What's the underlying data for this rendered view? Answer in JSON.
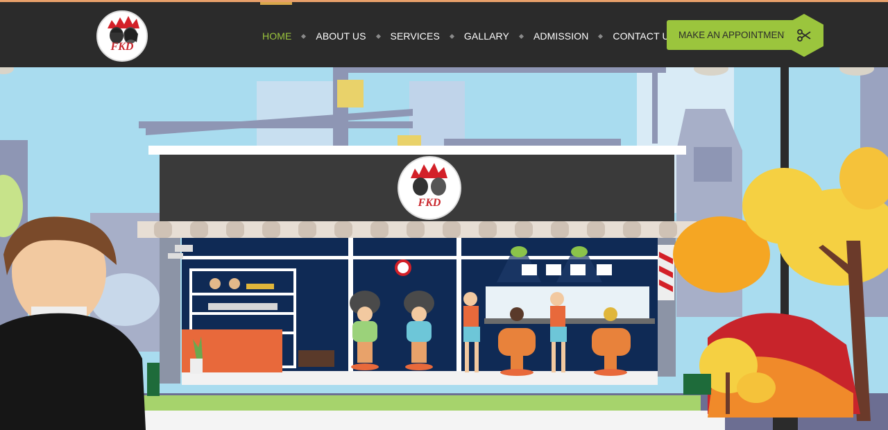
{
  "header": {
    "logo_text": "FKD",
    "nav": [
      {
        "label": "HOME",
        "active": true
      },
      {
        "label": "ABOUT US",
        "active": false
      },
      {
        "label": "SERVICES",
        "active": false
      },
      {
        "label": "GALLARY",
        "active": false
      },
      {
        "label": "ADMISSION",
        "active": false
      },
      {
        "label": "CONTACT US",
        "active": false
      }
    ],
    "cta_label": "MAKE AN APPOINTMENT",
    "cta_icon": "scissors-icon"
  },
  "hero": {
    "shop_sign_text": "FKD"
  },
  "colors": {
    "header_bg": "#2b2b2b",
    "accent_green": "#9bc53d",
    "sky": "#a9dcef",
    "awning": "#3a3a3a",
    "shop_interior": "#0f2a55"
  }
}
